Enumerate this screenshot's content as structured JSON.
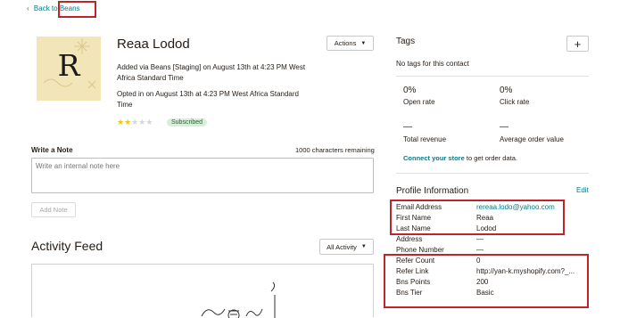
{
  "nav": {
    "back_prefix": "Back to",
    "back_link": "Beans"
  },
  "contact": {
    "avatar_letter": "R",
    "name": "Reaa Lodod",
    "added_line1": "Added via Beans [Staging] on August 13th at 4:23 PM West",
    "added_line2": "Africa Standard Time",
    "opted_line1": "Opted in on August 13th at 4:23 PM West Africa Standard",
    "opted_line2": "Time",
    "rating": 2,
    "rating_max": 5,
    "status_badge": "Subscribed",
    "actions_label": "Actions"
  },
  "note": {
    "title": "Write a Note",
    "chars_remaining": "1000 characters remaining",
    "placeholder": "Write an internal note here",
    "add_label": "Add Note"
  },
  "activity": {
    "title": "Activity Feed",
    "filter_label": "All Activity"
  },
  "tags": {
    "title": "Tags",
    "add_symbol": "+",
    "empty_text": "No tags for this contact"
  },
  "stats": {
    "open_rate_value": "0%",
    "open_rate_label": "Open rate",
    "click_rate_value": "0%",
    "click_rate_label": "Click rate",
    "total_revenue_value": "—",
    "total_revenue_label": "Total revenue",
    "avg_order_value": "—",
    "avg_order_label": "Average order value",
    "connect_link": "Connect your store",
    "connect_suffix": "to get order data."
  },
  "profile": {
    "title": "Profile Information",
    "edit_label": "Edit",
    "rows": [
      {
        "label": "Email Address",
        "value": "rereaa.lodo@yahoo.com"
      },
      {
        "label": "First Name",
        "value": "Reaa"
      },
      {
        "label": "Last Name",
        "value": "Lodod"
      },
      {
        "label": "Address",
        "value": "—"
      },
      {
        "label": "Phone Number",
        "value": "—"
      },
      {
        "label": "Refer Count",
        "value": "0"
      },
      {
        "label": "Refer Link",
        "value": "http://yan-k.myshopify.com?_..."
      },
      {
        "label": "Bns Points",
        "value": "200"
      },
      {
        "label": "Bns Tier",
        "value": "Basic"
      }
    ]
  },
  "colors": {
    "link": "#007c89",
    "highlight": "#c0242b",
    "badge_bg": "#d8eed9",
    "star": "#f0c419",
    "avatar_bg": "#f2e6b8"
  }
}
